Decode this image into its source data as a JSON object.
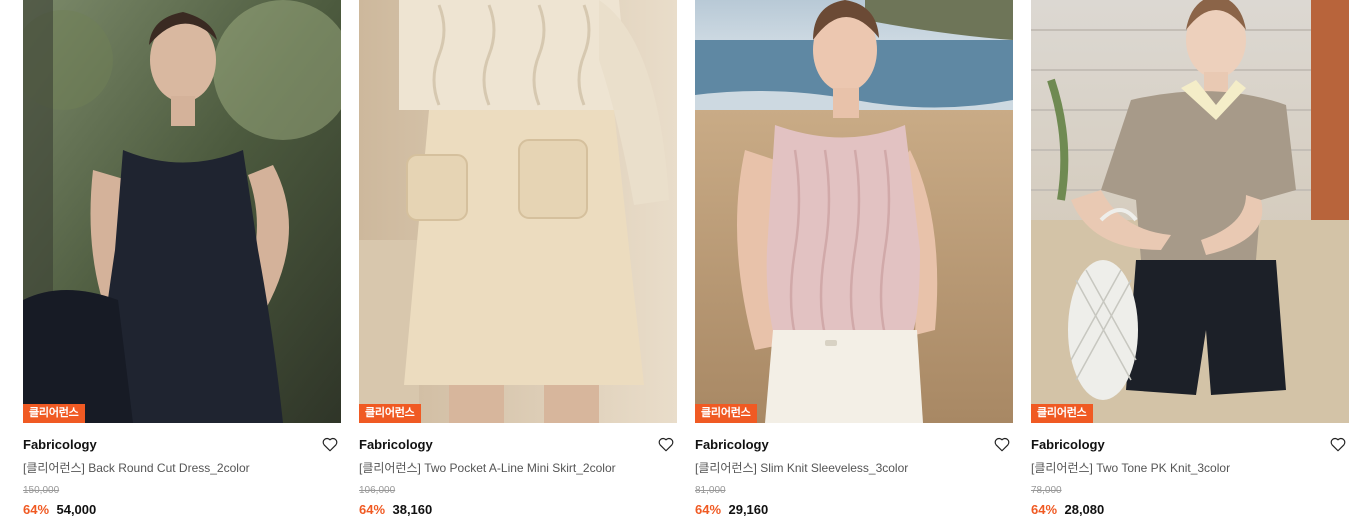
{
  "products": [
    {
      "image_desc": "woman in navy sleeveless dress",
      "badge": "클리어런스",
      "brand": "Fabricology",
      "name": "[클리어런스] Back Round Cut Dress_2color",
      "original_price": "150,000",
      "discount": "64%",
      "price": "54,000"
    },
    {
      "image_desc": "cream A-line mini skirt with pockets",
      "badge": "클리어런스",
      "brand": "Fabricology",
      "name": "[클리어런스] Two Pocket A-Line Mini Skirt_2color",
      "original_price": "106,000",
      "discount": "64%",
      "price": "38,160"
    },
    {
      "image_desc": "woman in pink cable knit sleeveless top at beach",
      "badge": "클리어런스",
      "brand": "Fabricology",
      "name": "[클리어런스] Slim Knit Sleeveless_3color",
      "original_price": "81,000",
      "discount": "64%",
      "price": "29,160"
    },
    {
      "image_desc": "woman in taupe PK knit top holding white bag",
      "badge": "클리어런스",
      "brand": "Fabricology",
      "name": "[클리어런스] Two Tone PK Knit_3color",
      "original_price": "78,000",
      "discount": "64%",
      "price": "28,080"
    }
  ],
  "colors": {
    "accent": "#f05a23",
    "text": "#111111",
    "muted": "#999999"
  },
  "icons": {
    "wishlist": "heart-outline-icon"
  }
}
